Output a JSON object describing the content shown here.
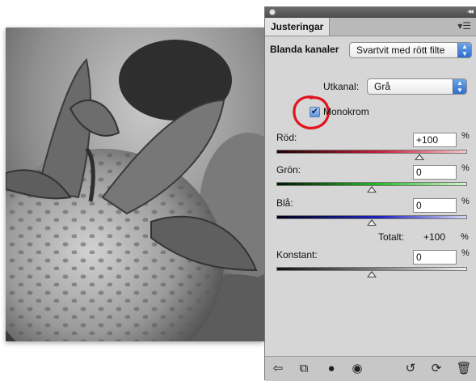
{
  "panel": {
    "tab_label": "Justeringar",
    "panel_menu_icon": "panel-menu-icon",
    "collapse_icon": "collapse-arrows-icon",
    "title": "Blanda kanaler",
    "preset_value": "Svartvit med rött filte",
    "output_channel_label": "Utkanal:",
    "output_channel_value": "Grå",
    "monochrome_label": "Monokrom",
    "monochrome_checked": true,
    "annotation_color": "#e0141e",
    "channels": [
      {
        "label": "Röd:",
        "value": "+100",
        "unit": "%",
        "slider": 100,
        "gradient": [
          "#1a0000",
          "#c8203a",
          "#f4c9cf"
        ]
      },
      {
        "label": "Grön:",
        "value": "0",
        "unit": "%",
        "slider": 0,
        "gradient": [
          "#001400",
          "#29c02a",
          "#d4f4d0"
        ]
      },
      {
        "label": "Blå:",
        "value": "0",
        "unit": "%",
        "slider": 0,
        "gradient": [
          "#00001a",
          "#1f23c2",
          "#d7d6f7"
        ]
      }
    ],
    "total_label": "Totalt:",
    "total_value": "+100",
    "total_unit": "%",
    "constant_label": "Konstant:",
    "constant_value": "0",
    "constant_unit": "%",
    "constant_slider": 0,
    "bottom_icons": [
      "back-arrow-icon",
      "clip-layer-icon",
      "visibility-icon",
      "eye-icon",
      "previous-state-icon",
      "reset-icon",
      "trash-icon"
    ]
  }
}
